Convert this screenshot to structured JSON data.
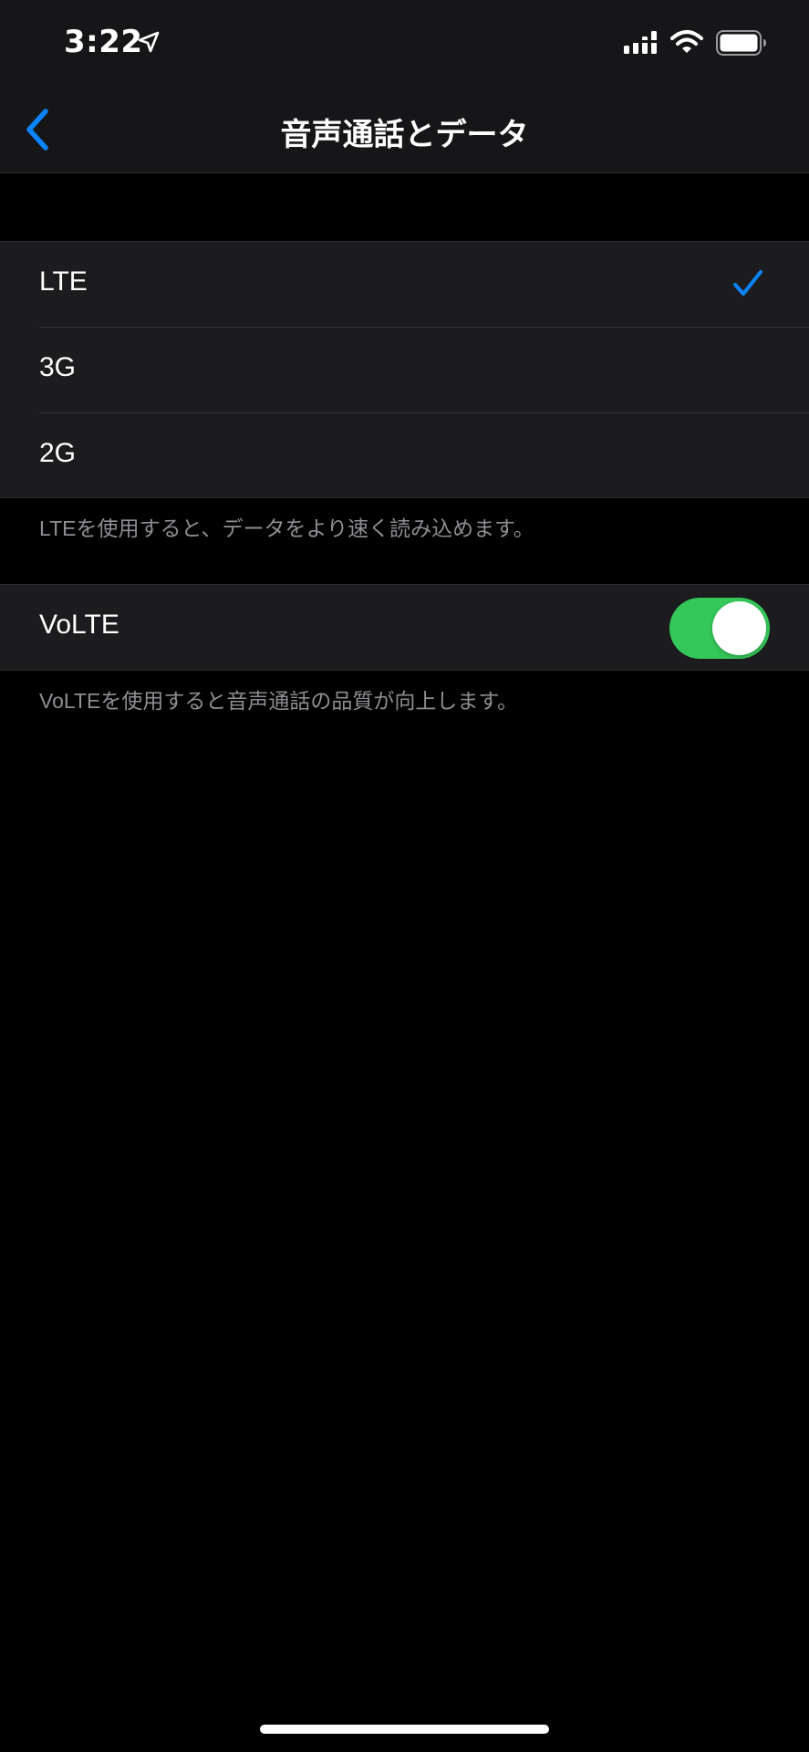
{
  "status_bar": {
    "time": "3:22",
    "location_icon": "location-arrow-icon",
    "signal_icon": "cellular-signal-icon",
    "wifi_icon": "wifi-icon",
    "battery_icon": "battery-icon"
  },
  "nav": {
    "title": "音声通話とデータ",
    "back_icon": "chevron-left-icon"
  },
  "network_options": {
    "items": [
      {
        "label": "LTE",
        "selected": true
      },
      {
        "label": "3G",
        "selected": false
      },
      {
        "label": "2G",
        "selected": false
      }
    ],
    "footer": "LTEを使用すると、データをより速く読み込めます。"
  },
  "volte": {
    "label": "VoLTE",
    "enabled": true,
    "footer": "VoLTEを使用すると音声通話の品質が向上します。"
  },
  "colors": {
    "accent": "#0a84ff",
    "toggle_on": "#34c759",
    "background": "#000000",
    "cell": "#1c1c1e"
  }
}
